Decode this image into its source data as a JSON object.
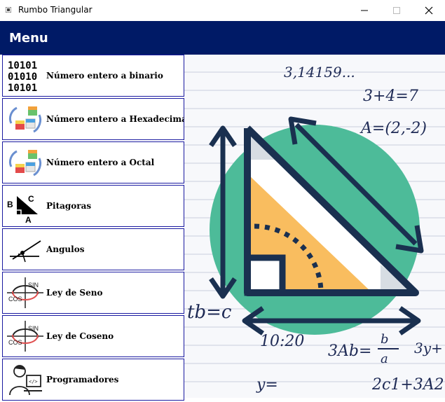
{
  "window": {
    "title": "Rumbo Triangular"
  },
  "header": {
    "title": "Menu"
  },
  "menu": {
    "items": [
      {
        "label": "Número entero a binario",
        "icon": "binary-icon"
      },
      {
        "label": "Número entero a Hexadecimal",
        "icon": "cubes-icon"
      },
      {
        "label": "Número entero a Octal",
        "icon": "cubes-icon"
      },
      {
        "label": "Pitagoras",
        "icon": "triangle-abc-icon"
      },
      {
        "label": "Angulos",
        "icon": "angle-icon"
      },
      {
        "label": "Ley de Seno",
        "icon": "sin-cos-icon"
      },
      {
        "label": "Ley de Coseno",
        "icon": "sin-cos-icon"
      },
      {
        "label": "Programadores",
        "icon": "programmer-icon"
      }
    ]
  },
  "icons": {
    "binary": [
      "10101",
      "01010",
      "10101"
    ],
    "triangle_labels": [
      "B",
      "C",
      "A"
    ],
    "sin_label": "SIN",
    "cos_label": "COS",
    "code_label": "</>"
  },
  "background": {
    "formulas": [
      "3,14159...",
      "3+4=7",
      "A=(2,-2)",
      "10:20",
      "3Ab=",
      "b",
      "a",
      "y=",
      "2c1+3A2",
      "tb=c",
      "3y+"
    ],
    "circle_color": "#4dbb99",
    "triangle_fill": "#f9bd5f",
    "line_color": "#1a3050"
  }
}
